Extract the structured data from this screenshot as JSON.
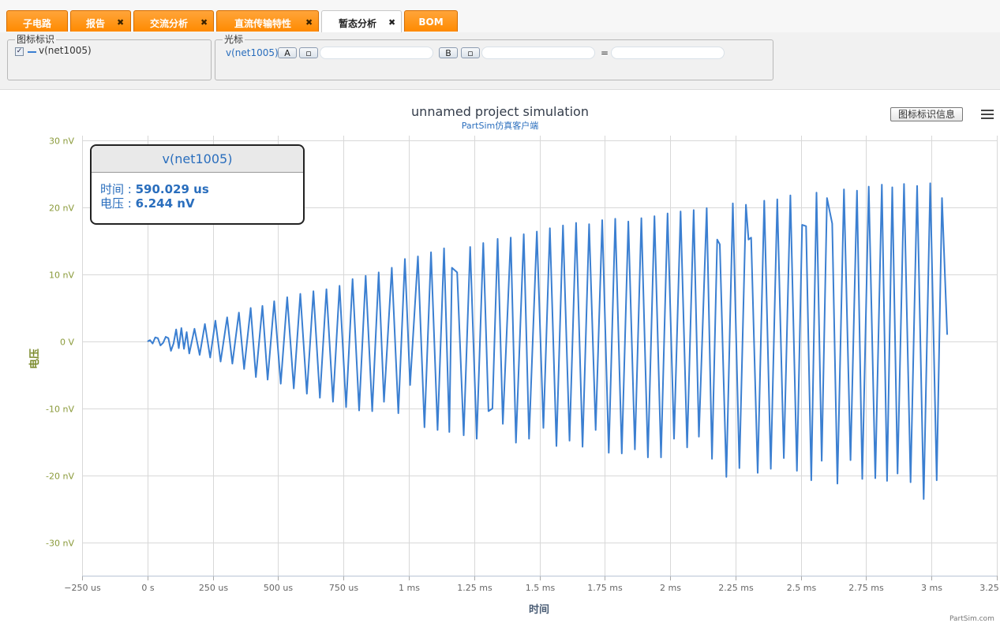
{
  "tabs": [
    {
      "label": "子电路",
      "closable": false,
      "active": false
    },
    {
      "label": "报告",
      "closable": true,
      "active": false
    },
    {
      "label": "交流分析",
      "closable": true,
      "active": false
    },
    {
      "label": "直流传输特性",
      "closable": true,
      "active": false
    },
    {
      "label": "暂态分析",
      "closable": true,
      "active": true
    },
    {
      "label": "BOM",
      "closable": false,
      "active": false
    }
  ],
  "close_glyph": "✖",
  "legend_panel": {
    "title": "图标标识",
    "items": [
      {
        "label": "v(net1005)",
        "checked": true
      }
    ]
  },
  "cursor_panel": {
    "title": "光标",
    "signal": "v(net1005)",
    "a_label": "A",
    "b_label": "B",
    "equals": "="
  },
  "toolbar_right": {
    "legend_info_button": "图标标识信息",
    "menu_icon": "hamburger-menu-icon"
  },
  "tooltip": {
    "series": "v(net1005)",
    "time_label": "时间 : ",
    "time_value": "590.029 us",
    "voltage_label": "电压 : ",
    "voltage_value": "6.244 nV"
  },
  "credit": "PartSim.com",
  "colors": {
    "series": "#3b7fd1",
    "tab_orange": "#ff9419",
    "grid": "#d8d8d8",
    "ytick": "#8a9a3a"
  },
  "chart_data": {
    "type": "line",
    "title": "unnamed project simulation",
    "subtitle": "PartSim仿真客户端",
    "xlabel": "时间",
    "ylabel": "电压",
    "xlim": [
      -0.25,
      3.25
    ],
    "ylim": [
      -35,
      30
    ],
    "x_ticks": [
      {
        "v": -0.25,
        "label": "−250 us"
      },
      {
        "v": 0,
        "label": "0 s"
      },
      {
        "v": 0.25,
        "label": "250 us"
      },
      {
        "v": 0.5,
        "label": "500 us"
      },
      {
        "v": 0.75,
        "label": "750 us"
      },
      {
        "v": 1.0,
        "label": "1 ms"
      },
      {
        "v": 1.25,
        "label": "1.25 ms"
      },
      {
        "v": 1.5,
        "label": "1.5 ms"
      },
      {
        "v": 1.75,
        "label": "1.75 ms"
      },
      {
        "v": 2.0,
        "label": "2 ms"
      },
      {
        "v": 2.25,
        "label": "2.25 ms"
      },
      {
        "v": 2.5,
        "label": "2.5 ms"
      },
      {
        "v": 2.75,
        "label": "2.75 ms"
      },
      {
        "v": 3.0,
        "label": "3 ms"
      },
      {
        "v": 3.25,
        "label": "3.25 ms"
      }
    ],
    "y_ticks": [
      {
        "v": 30,
        "label": "30 nV"
      },
      {
        "v": 20,
        "label": "20 nV"
      },
      {
        "v": 10,
        "label": "10 nV"
      },
      {
        "v": 0,
        "label": "0 V"
      },
      {
        "v": -10,
        "label": "-10 nV"
      },
      {
        "v": -20,
        "label": "-20 nV"
      },
      {
        "v": -30,
        "label": "-30 nV"
      }
    ],
    "grid": true,
    "series": [
      {
        "name": "v(net1005)",
        "x_unit": "ms",
        "y_unit": "nV",
        "points": [
          [
            0,
            0
          ],
          [
            0.01,
            0.2
          ],
          [
            0.02,
            -0.3
          ],
          [
            0.03,
            0.6
          ],
          [
            0.04,
            0.5
          ],
          [
            0.05,
            -0.6
          ],
          [
            0.06,
            -0.2
          ],
          [
            0.07,
            0.7
          ],
          [
            0.08,
            0.5
          ],
          [
            0.09,
            -1.4
          ],
          [
            0.1,
            -0.3
          ],
          [
            0.11,
            1.8
          ],
          [
            0.12,
            -1.0
          ],
          [
            0.13,
            2.0
          ],
          [
            0.14,
            -1.1
          ],
          [
            0.15,
            1.4
          ],
          [
            0.16,
            -1.8
          ],
          [
            0.18,
            1.9
          ],
          [
            0.2,
            -2.0
          ],
          [
            0.22,
            2.6
          ],
          [
            0.24,
            -2.4
          ],
          [
            0.26,
            3.1
          ],
          [
            0.28,
            -3.0
          ],
          [
            0.305,
            3.6
          ],
          [
            0.325,
            -3.3
          ],
          [
            0.35,
            4.3
          ],
          [
            0.37,
            -4.1
          ],
          [
            0.395,
            5.0
          ],
          [
            0.415,
            -5.3
          ],
          [
            0.44,
            5.3
          ],
          [
            0.46,
            -5.7
          ],
          [
            0.485,
            6.0
          ],
          [
            0.51,
            -6.3
          ],
          [
            0.535,
            6.6
          ],
          [
            0.56,
            -7.0
          ],
          [
            0.585,
            7.1
          ],
          [
            0.61,
            -7.8
          ],
          [
            0.635,
            7.5
          ],
          [
            0.66,
            -8.4
          ],
          [
            0.685,
            7.8
          ],
          [
            0.71,
            -9.0
          ],
          [
            0.735,
            8.3
          ],
          [
            0.76,
            -9.8
          ],
          [
            0.785,
            9.3
          ],
          [
            0.81,
            -10.3
          ],
          [
            0.835,
            9.8
          ],
          [
            0.86,
            -10.4
          ],
          [
            0.885,
            10.3
          ],
          [
            0.905,
            -9.0
          ],
          [
            0.935,
            11.0
          ],
          [
            0.96,
            -10.7
          ],
          [
            0.985,
            12.3
          ],
          [
            1.005,
            -6.5
          ],
          [
            1.035,
            12.7
          ],
          [
            1.06,
            -12.8
          ],
          [
            1.085,
            13.3
          ],
          [
            1.11,
            -13.2
          ],
          [
            1.135,
            13.9
          ],
          [
            1.155,
            -13.5
          ],
          [
            1.165,
            11.0
          ],
          [
            1.185,
            10.3
          ],
          [
            1.21,
            -14.0
          ],
          [
            1.235,
            14.1
          ],
          [
            1.26,
            -14.5
          ],
          [
            1.285,
            14.7
          ],
          [
            1.305,
            -10.4
          ],
          [
            1.32,
            -10.0
          ],
          [
            1.34,
            15.3
          ],
          [
            1.36,
            -12.3
          ],
          [
            1.39,
            15.5
          ],
          [
            1.41,
            -15.1
          ],
          [
            1.44,
            16.0
          ],
          [
            1.46,
            -14.5
          ],
          [
            1.49,
            16.4
          ],
          [
            1.515,
            -12.9
          ],
          [
            1.54,
            16.9
          ],
          [
            1.565,
            -15.6
          ],
          [
            1.59,
            17.3
          ],
          [
            1.615,
            -14.8
          ],
          [
            1.64,
            17.7
          ],
          [
            1.665,
            -15.7
          ],
          [
            1.69,
            17.5
          ],
          [
            1.715,
            -13.2
          ],
          [
            1.74,
            18.1
          ],
          [
            1.765,
            -16.6
          ],
          [
            1.79,
            18.3
          ],
          [
            1.815,
            -16.7
          ],
          [
            1.84,
            17.9
          ],
          [
            1.865,
            -16.1
          ],
          [
            1.89,
            18.4
          ],
          [
            1.915,
            -17.3
          ],
          [
            1.94,
            18.7
          ],
          [
            1.965,
            -17.3
          ],
          [
            1.99,
            19.1
          ],
          [
            2.015,
            -14.5
          ],
          [
            2.04,
            19.4
          ],
          [
            2.065,
            -15.8
          ],
          [
            2.09,
            19.6
          ],
          [
            2.11,
            -14.2
          ],
          [
            2.14,
            19.9
          ],
          [
            2.16,
            -17.5
          ],
          [
            2.18,
            15.2
          ],
          [
            2.19,
            14.5
          ],
          [
            2.215,
            -20.2
          ],
          [
            2.24,
            20.6
          ],
          [
            2.265,
            -18.9
          ],
          [
            2.29,
            20.4
          ],
          [
            2.3,
            15.2
          ],
          [
            2.31,
            15.5
          ],
          [
            2.335,
            -19.6
          ],
          [
            2.36,
            21.0
          ],
          [
            2.385,
            -19.0
          ],
          [
            2.41,
            21.2
          ],
          [
            2.435,
            -17.4
          ],
          [
            2.46,
            21.8
          ],
          [
            2.485,
            -19.3
          ],
          [
            2.505,
            17.4
          ],
          [
            2.52,
            17.2
          ],
          [
            2.54,
            -20.7
          ],
          [
            2.56,
            22.2
          ],
          [
            2.58,
            -17.8
          ],
          [
            2.6,
            21.4
          ],
          [
            2.62,
            17.6
          ],
          [
            2.64,
            -21.2
          ],
          [
            2.665,
            22.7
          ],
          [
            2.69,
            -17.7
          ],
          [
            2.715,
            22.5
          ],
          [
            2.735,
            -20.5
          ],
          [
            2.76,
            23.1
          ],
          [
            2.785,
            -20.4
          ],
          [
            2.81,
            23.4
          ],
          [
            2.83,
            -20.8
          ],
          [
            2.85,
            23.0
          ],
          [
            2.87,
            -19.7
          ],
          [
            2.895,
            23.5
          ],
          [
            2.92,
            -21.0
          ],
          [
            2.945,
            23.2
          ],
          [
            2.97,
            -23.5
          ],
          [
            2.995,
            23.6
          ],
          [
            3.02,
            -20.7
          ],
          [
            3.04,
            21.4
          ],
          [
            3.06,
            1.0
          ]
        ]
      }
    ]
  }
}
